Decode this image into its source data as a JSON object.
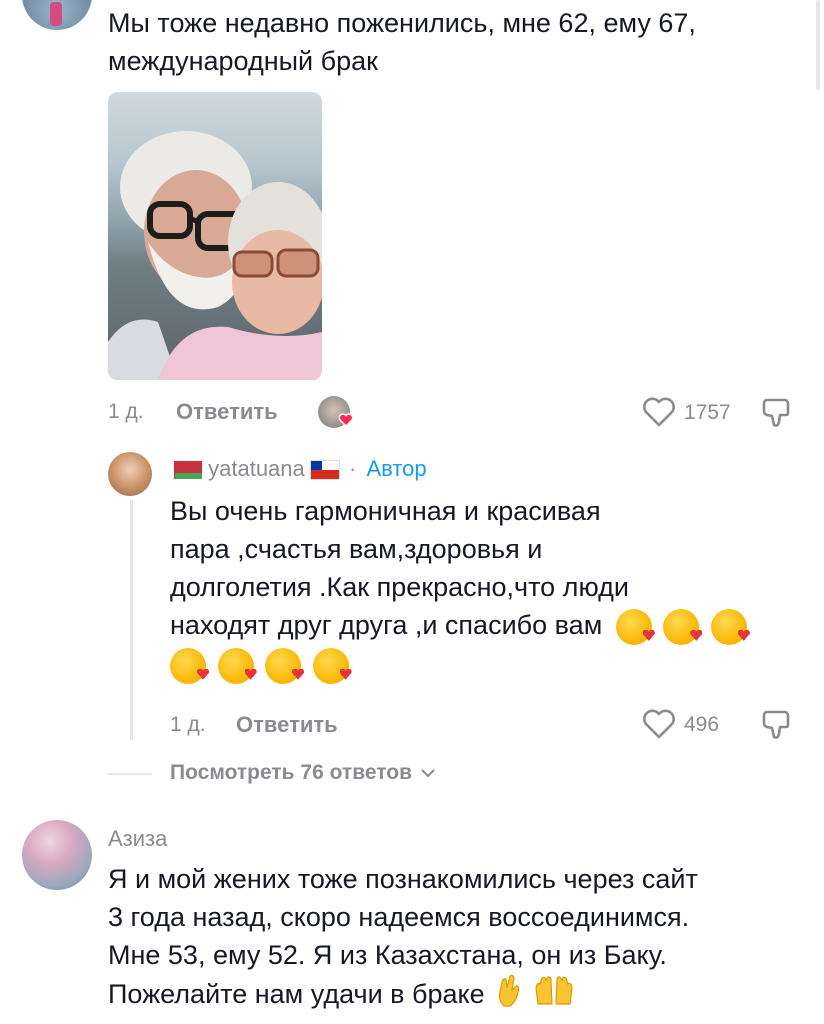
{
  "comment1": {
    "text_line1": "Мы тоже недавно поженились, мне 62, ему 67,",
    "text_line2": "международный брак",
    "time": "1 д.",
    "reply_label": "Ответить",
    "likes": "1757"
  },
  "reply": {
    "username": "yatatuana",
    "separator": "·",
    "author_badge": "Автор",
    "text_lines": [
      "Вы очень гармоничная и красивая",
      "пара ,счастья вам,здоровья и",
      "долголетия .Как прекрасно,что люди",
      "находят друг друга ,и спасибо вам"
    ],
    "time": "1 д.",
    "reply_label": "Ответить",
    "likes": "496",
    "view_replies": "Посмотреть 76 ответов"
  },
  "comment2": {
    "username": "Азиза",
    "text_lines": [
      "Я и мой жених тоже познакомились через сайт",
      "3 года назад, скоро надеемся воссоединимся.",
      "Мне 53, ему 52. Я из Казахстана, он из Баку.",
      "Пожелайте нам удачи в браке"
    ]
  },
  "colors": {
    "text": "#161823",
    "muted": "#8a8b91",
    "author_badge": "#1a9be6",
    "heart_badge": "#fe2c55"
  },
  "icons": [
    "heart-outline-icon",
    "dislike-icon",
    "chevron-down-icon",
    "kiss-emoji",
    "crossed-fingers-emoji",
    "raising-hands-emoji"
  ]
}
